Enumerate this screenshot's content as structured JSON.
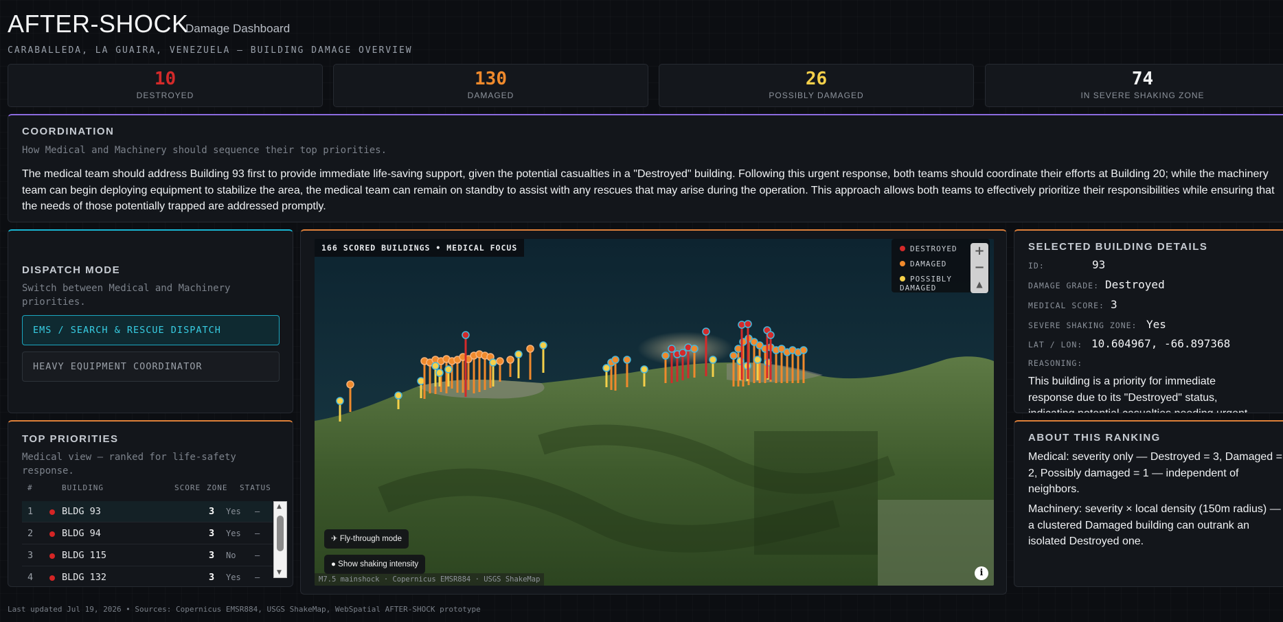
{
  "header": {
    "title": "AFTER-SHOCK",
    "subtitle": "Damage Dashboard",
    "location": "CARABALLEDA, LA GUAIRA, VENEZUELA — BUILDING DAMAGE OVERVIEW"
  },
  "stats": [
    {
      "value": "10",
      "label": "DESTROYED",
      "color": "#d42a2a"
    },
    {
      "value": "130",
      "label": "DAMAGED",
      "color": "#f08a2c"
    },
    {
      "value": "26",
      "label": "POSSIBLY DAMAGED",
      "color": "#f5d04a"
    },
    {
      "value": "74",
      "label": "IN SEVERE SHAKING ZONE",
      "color": "#f4f5f6"
    }
  ],
  "coordination": {
    "title": "COORDINATION",
    "subtitle": "How Medical and Machinery should sequence their top priorities.",
    "body": "The medical team should address Building 93 first to provide immediate life-saving support, given the potential casualties in a \"Destroyed\" building. Following this urgent response, both teams should coordinate their efforts at Building 20; while the machinery team can begin deploying equipment to stabilize the area, the medical team can remain on standby to assist with any rescues that may arise during the operation. This approach allows both teams to effectively prioritize their responsibilities while ensuring that the needs of those potentially trapped are addressed promptly."
  },
  "dispatch": {
    "title": "DISPATCH MODE",
    "subtitle": "Switch between Medical and Machinery priorities.",
    "modes": [
      "EMS / SEARCH & RESCUE DISPATCH",
      "HEAVY EQUIPMENT COORDINATOR"
    ],
    "active_mode": "EMS / SEARCH & RESCUE DISPATCH"
  },
  "priorities": {
    "title": "TOP PRIORITIES",
    "subtitle": "Medical view — ranked for life-safety response.",
    "columns": [
      "#",
      "BUILDING",
      "SCORE",
      "ZONE",
      "STATUS"
    ],
    "rows": [
      {
        "rank": "1",
        "building": "BLDG 93",
        "score": "3",
        "zone": "Yes",
        "status": "—"
      },
      {
        "rank": "2",
        "building": "BLDG 94",
        "score": "3",
        "zone": "Yes",
        "status": "—"
      },
      {
        "rank": "3",
        "building": "BLDG 115",
        "score": "3",
        "zone": "No",
        "status": "—"
      },
      {
        "rank": "4",
        "building": "BLDG 132",
        "score": "3",
        "zone": "Yes",
        "status": "—"
      }
    ]
  },
  "map": {
    "badge": "166 SCORED BUILDINGS • MEDICAL FOCUS",
    "legend": [
      {
        "label": "DESTROYED",
        "color": "#d42a2a"
      },
      {
        "label": "DAMAGED",
        "color": "#f08a2c"
      },
      {
        "label": "POSSIBLY DAMAGED",
        "color": "#f5d04a"
      }
    ],
    "zoom_in": "+",
    "zoom_out": "−",
    "compass": "▲",
    "flythrough_icon": "✈",
    "flythrough": "Fly-through mode",
    "shaking_icon": "●",
    "shaking": "Show shaking intensity",
    "attribution": "M7.5 mainshock · Copernicus EMSR884 · USGS ShakeMap",
    "info": "i"
  },
  "details": {
    "title": "SELECTED BUILDING DETAILS",
    "id_label": "ID:",
    "id": "93",
    "grade_label": "DAMAGE GRADE:",
    "grade": "Destroyed",
    "score_label": "MEDICAL SCORE:",
    "score": "3",
    "zone_label": "SEVERE SHAKING ZONE:",
    "zone": "Yes",
    "latlon_label": "LAT / LON:",
    "latlon": "10.604967, -66.897368",
    "reasoning_label": "REASONING:",
    "reasoning": "This building is a priority for immediate response due to its \"Destroyed\" status, indicating potential casualties needing urgent"
  },
  "about": {
    "title": "ABOUT THIS RANKING",
    "medical": "Medical: severity only — Destroyed = 3, Damaged = 2, Possibly damaged = 1 — independent of neighbors.",
    "machinery": "Machinery: severity × local density (150m radius) — a clustered Damaged building can outrank an isolated Destroyed one."
  },
  "footer": "Last updated Jul 19, 2026 • Sources: Copernicus EMSR884, USGS ShakeMap, WebSpatial AFTER-SHOCK prototype"
}
